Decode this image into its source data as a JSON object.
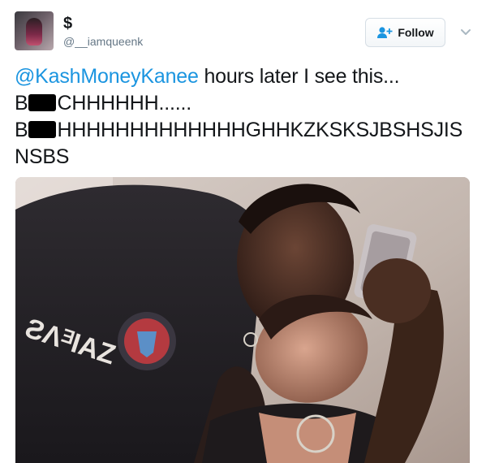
{
  "user": {
    "display_name": "$",
    "handle": "@__iamqueenk"
  },
  "follow_button": {
    "label": "Follow",
    "icon": "add-user-icon"
  },
  "menu": {
    "icon": "chevron-down-icon"
  },
  "tweet": {
    "mention": "@KashMoneyKanee",
    "line1_rest": " hours later I see this...",
    "line2_start": "B",
    "line2_end": "CHHHHHH......",
    "line3_start": "B",
    "line3_end": "HHHHHHHHHHHHHGHHKZKSKSJBSHSJIS",
    "line4": "NSBS"
  },
  "colors": {
    "link": "#1b95e0",
    "text": "#14171a",
    "muted": "#657786",
    "button_border": "#d6dee5"
  }
}
